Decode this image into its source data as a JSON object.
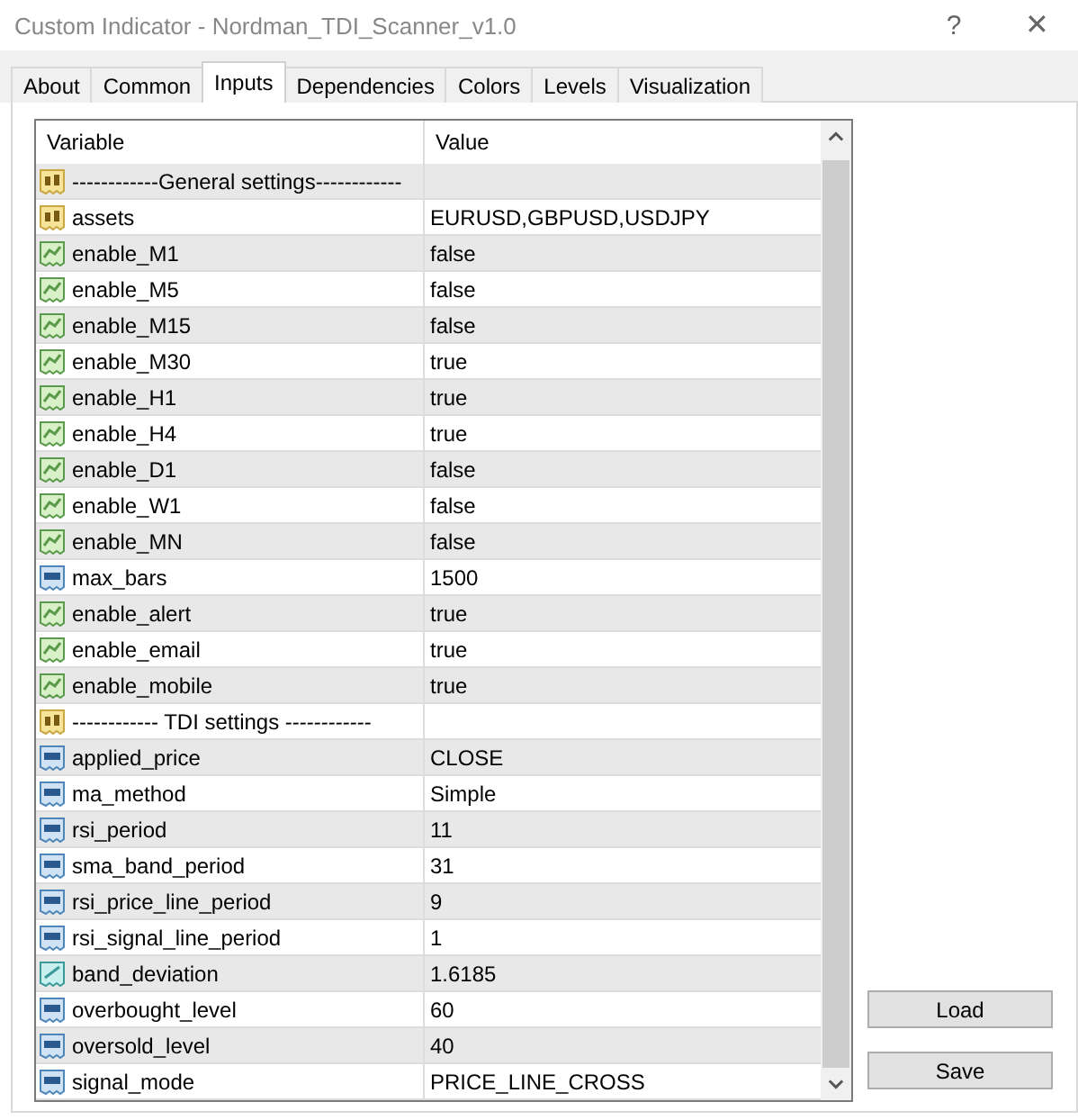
{
  "window": {
    "title": "Custom Indicator - Nordman_TDI_Scanner_v1.0",
    "help": "?",
    "close": "✕"
  },
  "tabs": [
    {
      "label": "About",
      "selected": false
    },
    {
      "label": "Common",
      "selected": false
    },
    {
      "label": "Inputs",
      "selected": true
    },
    {
      "label": "Dependencies",
      "selected": false
    },
    {
      "label": "Colors",
      "selected": false
    },
    {
      "label": "Levels",
      "selected": false
    },
    {
      "label": "Visualization",
      "selected": false
    }
  ],
  "table": {
    "columns": [
      "Variable",
      "Value"
    ],
    "rows": [
      {
        "kind": "string",
        "variable": "------------General settings------------",
        "value": ""
      },
      {
        "kind": "string",
        "variable": "assets",
        "value": "EURUSD,GBPUSD,USDJPY"
      },
      {
        "kind": "bool",
        "variable": "enable_M1",
        "value": "false"
      },
      {
        "kind": "bool",
        "variable": "enable_M5",
        "value": "false"
      },
      {
        "kind": "bool",
        "variable": "enable_M15",
        "value": "false"
      },
      {
        "kind": "bool",
        "variable": "enable_M30",
        "value": "true"
      },
      {
        "kind": "bool",
        "variable": "enable_H1",
        "value": "true"
      },
      {
        "kind": "bool",
        "variable": "enable_H4",
        "value": "true"
      },
      {
        "kind": "bool",
        "variable": "enable_D1",
        "value": "false"
      },
      {
        "kind": "bool",
        "variable": "enable_W1",
        "value": "false"
      },
      {
        "kind": "bool",
        "variable": "enable_MN",
        "value": "false"
      },
      {
        "kind": "int",
        "variable": "max_bars",
        "value": "1500"
      },
      {
        "kind": "bool",
        "variable": "enable_alert",
        "value": "true"
      },
      {
        "kind": "bool",
        "variable": "enable_email",
        "value": "true"
      },
      {
        "kind": "bool",
        "variable": "enable_mobile",
        "value": "true"
      },
      {
        "kind": "string",
        "variable": "------------ TDI settings ------------",
        "value": ""
      },
      {
        "kind": "int",
        "variable": "applied_price",
        "value": "CLOSE"
      },
      {
        "kind": "int",
        "variable": "ma_method",
        "value": "Simple"
      },
      {
        "kind": "int",
        "variable": "rsi_period",
        "value": "11"
      },
      {
        "kind": "int",
        "variable": "sma_band_period",
        "value": "31"
      },
      {
        "kind": "int",
        "variable": "rsi_price_line_period",
        "value": "9"
      },
      {
        "kind": "int",
        "variable": "rsi_signal_line_period",
        "value": "1"
      },
      {
        "kind": "double",
        "variable": "band_deviation",
        "value": "1.6185"
      },
      {
        "kind": "int",
        "variable": "overbought_level",
        "value": "60"
      },
      {
        "kind": "int",
        "variable": "oversold_level",
        "value": "40"
      },
      {
        "kind": "int",
        "variable": "signal_mode",
        "value": "PRICE_LINE_CROSS"
      }
    ]
  },
  "buttons": [
    "Load",
    "Save"
  ]
}
